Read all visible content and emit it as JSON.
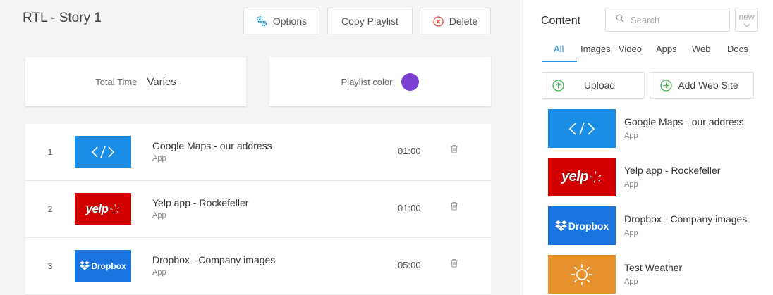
{
  "playlist": {
    "title": "RTL - Story 1",
    "toolbar": {
      "options_label": "Options",
      "copy_label": "Copy Playlist",
      "delete_label": "Delete"
    },
    "total_time_label": "Total Time",
    "total_time_value": "Varies",
    "color_label": "Playlist color",
    "color_value": "#7b3fd1",
    "items": [
      {
        "index": "1",
        "name": "Google Maps - our address",
        "type": "App",
        "duration": "01:00",
        "thumb": "code-icon"
      },
      {
        "index": "2",
        "name": "Yelp app - Rockefeller",
        "type": "App",
        "duration": "01:00",
        "thumb": "yelp-logo"
      },
      {
        "index": "3",
        "name": "Dropbox - Company images",
        "type": "App",
        "duration": "05:00",
        "thumb": "dropbox-logo"
      }
    ]
  },
  "content": {
    "title": "Content",
    "search_placeholder": "Search",
    "sort_label": "new",
    "tabs": [
      {
        "label": "All",
        "active": true
      },
      {
        "label": "Images",
        "active": false
      },
      {
        "label": "Video",
        "active": false
      },
      {
        "label": "Apps",
        "active": false
      },
      {
        "label": "Web",
        "active": false
      },
      {
        "label": "Docs",
        "active": false
      }
    ],
    "upload_label": "Upload",
    "add_web_label": "Add Web Site",
    "items": [
      {
        "name": "Google Maps - our address",
        "type": "App",
        "thumb": "code-icon"
      },
      {
        "name": "Yelp app - Rockefeller",
        "type": "App",
        "thumb": "yelp-logo"
      },
      {
        "name": "Dropbox - Company images",
        "type": "App",
        "thumb": "dropbox-logo"
      },
      {
        "name": "Test Weather",
        "type": "App",
        "thumb": "sun-icon"
      }
    ]
  },
  "logo_text": {
    "yelp": "yelp",
    "dropbox": "Dropbox"
  },
  "colors": {
    "accent": "#2b8fd6",
    "code_bg": "#1a8ee6",
    "yelp_bg": "#d20000",
    "dropbox_bg": "#1a74e0",
    "weather_bg": "#e8922d",
    "delete_red": "#e0453a",
    "add_green": "#3fb34f"
  }
}
